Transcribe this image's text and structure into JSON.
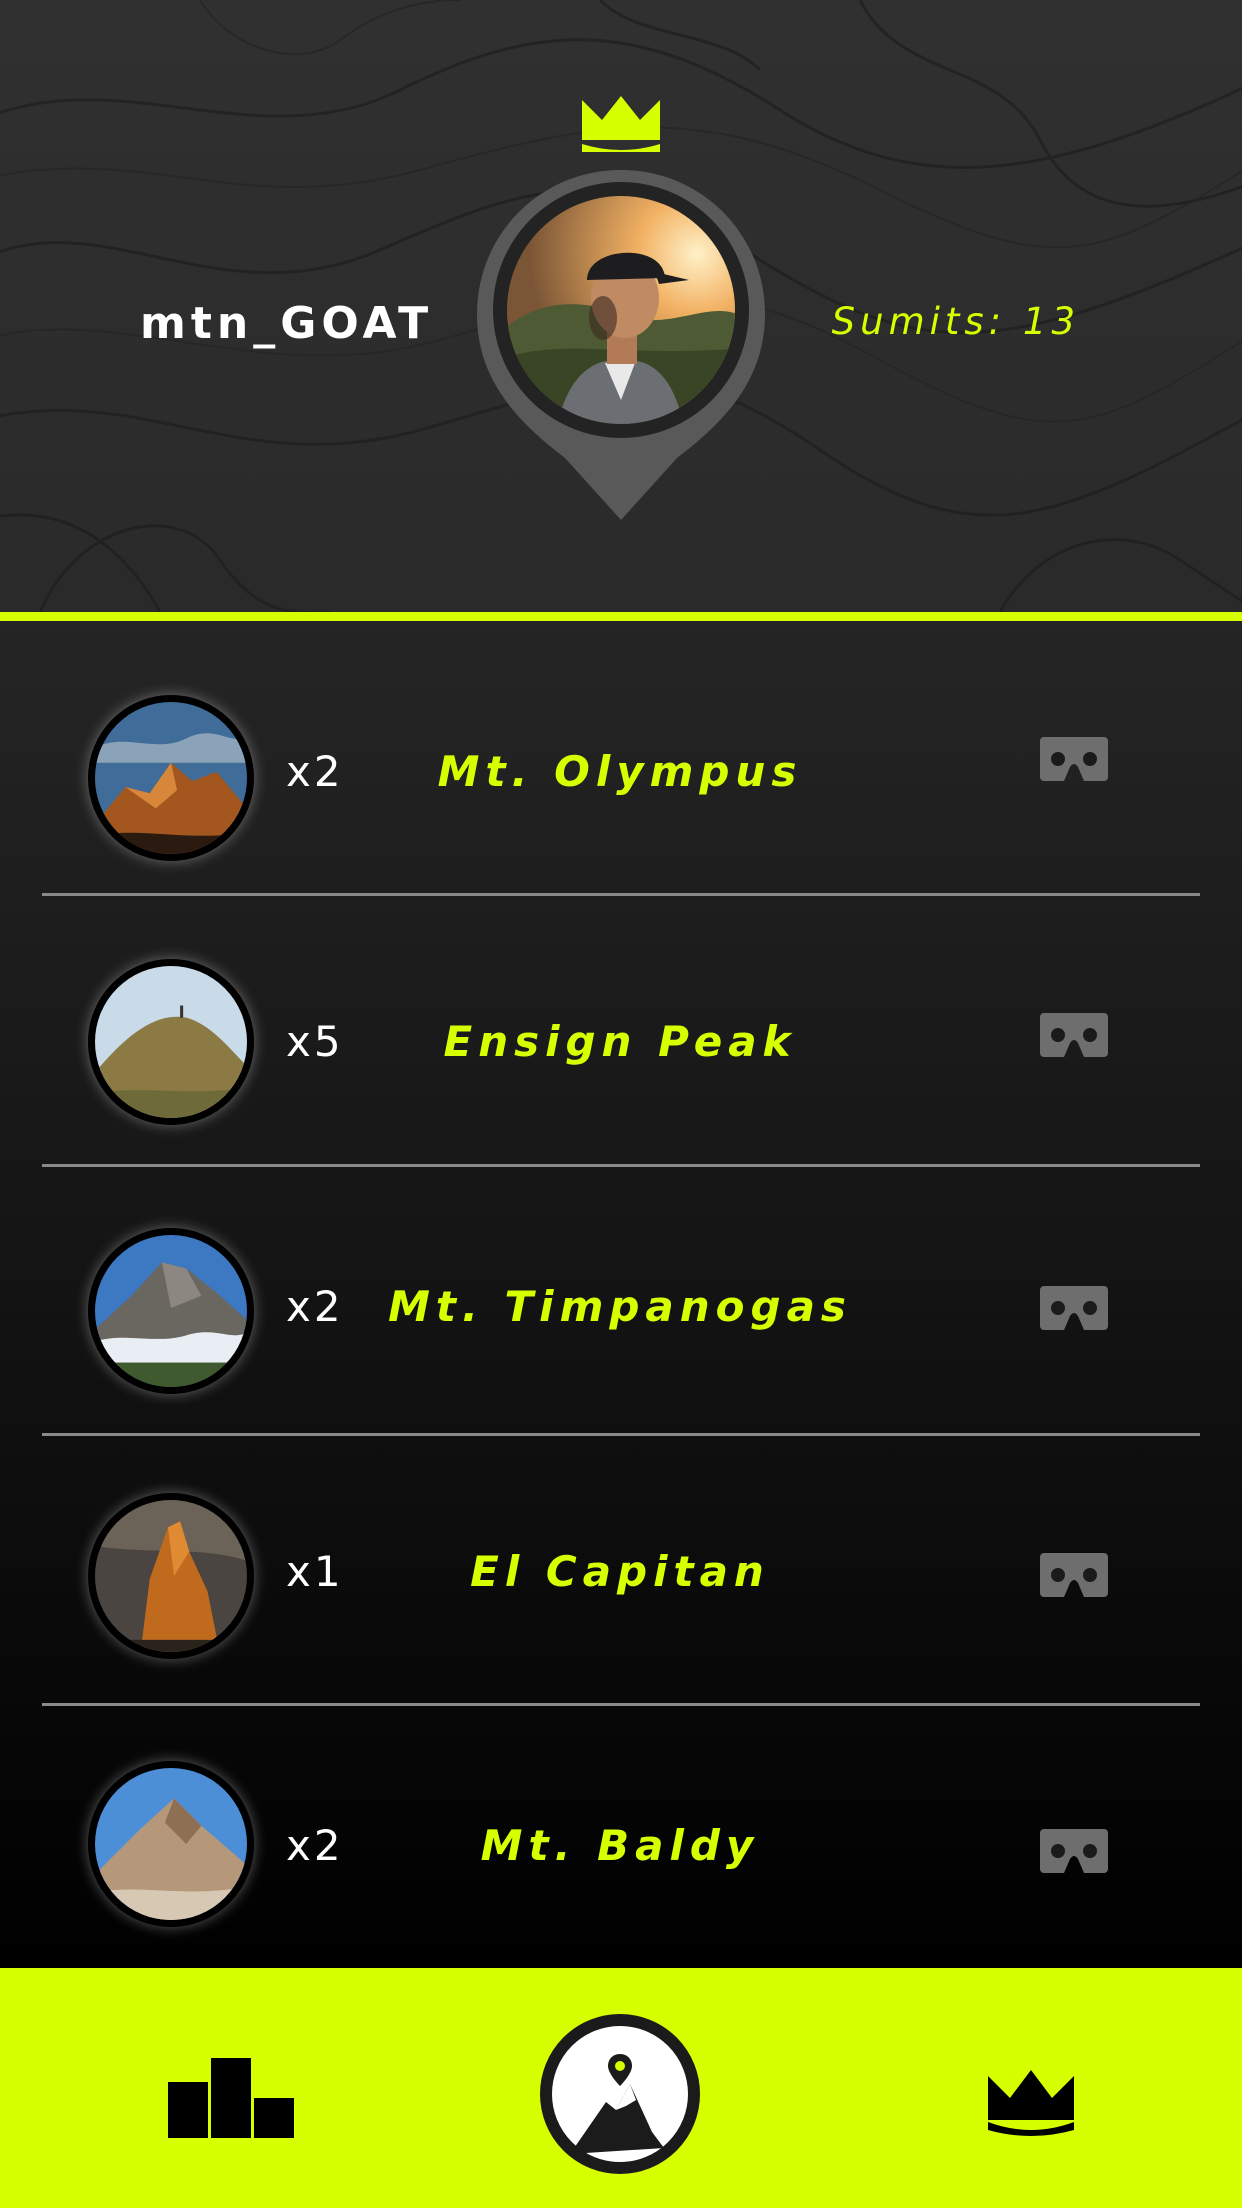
{
  "profile": {
    "username": "mtn_GOAT",
    "summits_label": "Sumits: 13"
  },
  "colors": {
    "accent": "#d6ff00",
    "header_bg": "#2d2d2d",
    "list_bg_top": "#252525",
    "list_bg_bottom": "#000000",
    "divider": "#8a8a8a",
    "vr_icon": "#6e6e6e"
  },
  "icons": {
    "top": "crown-icon",
    "avatar": "location-pin-avatar",
    "row_action": "vr-headset-icon",
    "nav": [
      "leaderboard-icon",
      "mountain-summit-icon",
      "crown-icon"
    ]
  },
  "peaks": [
    {
      "count": "x2",
      "name": "Mt. Olympus"
    },
    {
      "count": "x5",
      "name": "Ensign Peak"
    },
    {
      "count": "x2",
      "name": "Mt. Timpanogas"
    },
    {
      "count": "x1",
      "name": "El Capitan"
    },
    {
      "count": "x2",
      "name": "Mt. Baldy"
    }
  ]
}
